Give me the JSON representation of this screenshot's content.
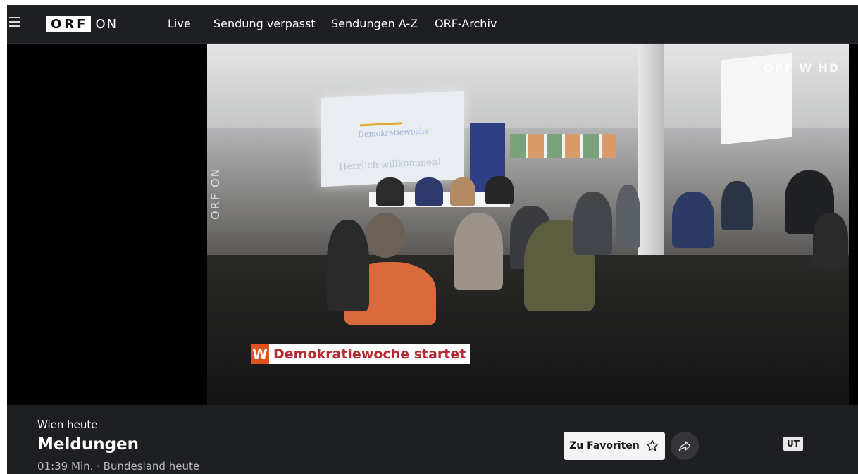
{
  "nav": {
    "logo_box": "ORF",
    "logo_suffix": "ON",
    "items": [
      "Live",
      "Sendung verpasst",
      "Sendungen A-Z",
      "ORF-Archiv"
    ]
  },
  "player": {
    "watermark_vertical": "ORF ON",
    "channel_logo": "ORF W HD",
    "lower_third_badge": "W",
    "lower_third_text": "Demokratiewoche startet",
    "screen_title": "Demokratiewoche",
    "screen_welcome": "Herzlich willkommen!"
  },
  "info": {
    "program": "Wien heute",
    "title": "Meldungen",
    "meta": "01:39 Min. · Bundesland heute",
    "favorite_label": "Zu Favoriten",
    "subtitle_badge": "UT"
  },
  "icons": {
    "menu": "hamburger-icon",
    "favorite": "star-icon",
    "share": "share-icon"
  },
  "colors": {
    "background": "#1e1f22",
    "lower_third_accent": "#e0531f",
    "lower_third_text": "#b42a2f"
  }
}
